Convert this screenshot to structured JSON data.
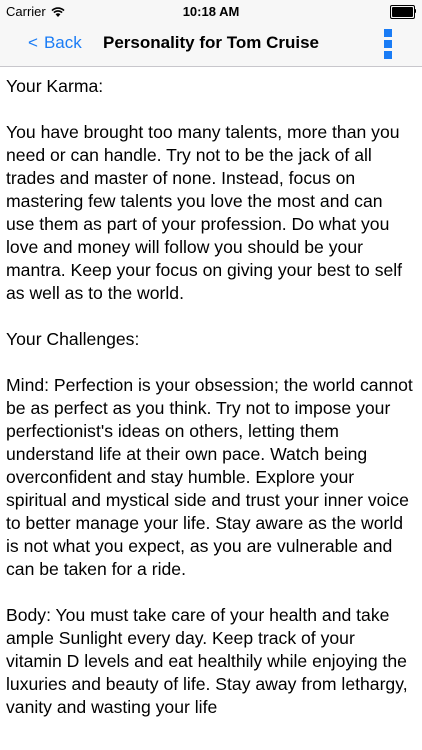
{
  "status_bar": {
    "carrier": "Carrier",
    "time": "10:18 AM",
    "battery_level": 1.0
  },
  "nav": {
    "back_label": "Back",
    "back_chevron": "<",
    "title": "Personality for Tom Cruise",
    "more_icon": "more-vertical-icon",
    "accent_color": "#1a7cf5"
  },
  "content": {
    "paragraphs": [
      "Your Karma:",
      "You have brought too many talents, more than you need or can handle. Try not to be the jack of all trades and master of none. Instead, focus on mastering few talents you love the most and can use them as part of your profession. Do what you love and money will follow you should be your mantra. Keep your focus on giving your best to self as well as to the world.",
      "Your Challenges:",
      "Mind: Perfection is your obsession; the world cannot be as perfect as you think. Try not to impose your perfectionist's ideas on others, letting them understand life at their own pace. Watch being overconfident and stay humble. Explore your spiritual and mystical side and trust your inner voice to better manage your life. Stay aware as the world is not what you expect, as you are vulnerable and can be taken for a ride.",
      "Body: You must take care of your health and take ample Sunlight every day. Keep track of your vitamin D levels and eat healthily while enjoying the luxuries and beauty of life. Stay away from lethargy, vanity and wasting your life"
    ]
  }
}
